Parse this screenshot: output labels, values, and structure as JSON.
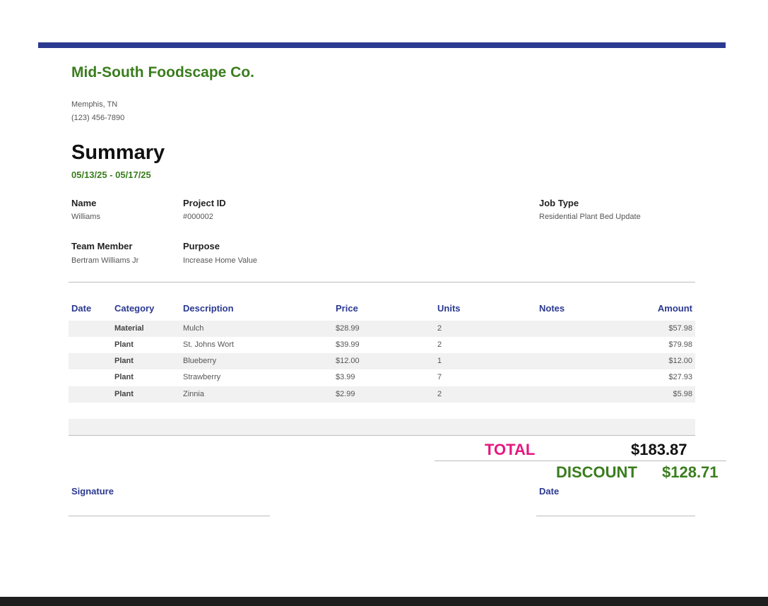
{
  "company": {
    "name": "Mid-South Foodscape Co.",
    "city": "Memphis, TN",
    "phone": "(123) 456-7890"
  },
  "summary": {
    "title": "Summary",
    "date_range": "05/13/25 - 05/17/25"
  },
  "details": {
    "name_label": "Name",
    "name_value": "Williams",
    "project_label": "Project ID",
    "project_value": "#000002",
    "job_label": "Job Type",
    "job_value": "Residential Plant Bed Update",
    "team_label": "Team Member",
    "team_value": "Bertram Williams Jr",
    "purpose_label": "Purpose",
    "purpose_value": "Increase Home Value"
  },
  "table": {
    "headers": [
      "Date",
      "Category",
      "Description",
      "Price",
      "Units",
      "Notes",
      "Amount"
    ],
    "rows": [
      {
        "date": "",
        "category": "Material",
        "description": "Mulch",
        "price": "$28.99",
        "units": "2",
        "notes": "",
        "amount": "$57.98"
      },
      {
        "date": "",
        "category": "Plant",
        "description": "St. Johns Wort",
        "price": "$39.99",
        "units": "2",
        "notes": "",
        "amount": "$79.98"
      },
      {
        "date": "",
        "category": "Plant",
        "description": "Blueberry",
        "price": "$12.00",
        "units": "1",
        "notes": "",
        "amount": "$12.00"
      },
      {
        "date": "",
        "category": "Plant",
        "description": "Strawberry",
        "price": "$3.99",
        "units": "7",
        "notes": "",
        "amount": "$27.93"
      },
      {
        "date": "",
        "category": "Plant",
        "description": "Zinnia",
        "price": "$2.99",
        "units": "2",
        "notes": "",
        "amount": "$5.98"
      }
    ]
  },
  "totals": {
    "total_label": "TOTAL",
    "total_value": "$183.87",
    "discount_label": "DISCOUNT",
    "discount_value": "$128.71"
  },
  "signoff": {
    "signature_label": "Signature",
    "date_label": "Date"
  },
  "colors": {
    "accent_blue": "#2b3990",
    "brand_green": "#3a7d1e",
    "total_pink": "#e6177f"
  }
}
